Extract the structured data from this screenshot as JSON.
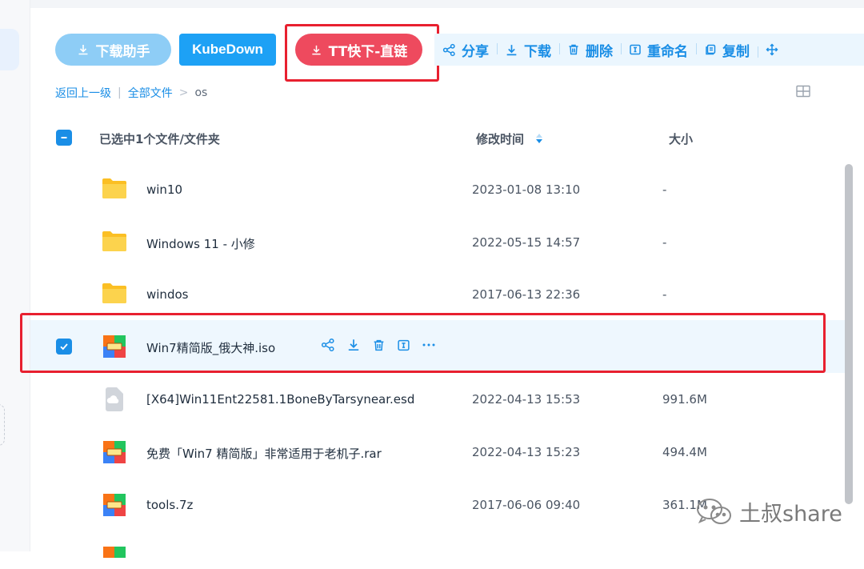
{
  "toolbar": {
    "helper_label": "下载助手",
    "kube_label": "KubeDown",
    "tt_label": "TT快下-直链",
    "actions": [
      {
        "label": "分享",
        "icon": "share-icon"
      },
      {
        "label": "下载",
        "icon": "download-icon"
      },
      {
        "label": "删除",
        "icon": "trash-icon"
      },
      {
        "label": "重命名",
        "icon": "rename-icon"
      },
      {
        "label": "复制",
        "icon": "copy-icon"
      }
    ]
  },
  "breadcrumb": {
    "back": "返回上一级",
    "sep1": "|",
    "all": "全部文件",
    "sep2": ">",
    "current": "os"
  },
  "list_header": {
    "selected_text": "已选中1个文件/文件夹",
    "mtime": "修改时间",
    "size": "大小"
  },
  "files": [
    {
      "name": "win10",
      "mtime": "2023-01-08 13:10",
      "size": "-",
      "type": "folder"
    },
    {
      "name": "Windows 11 - 小修",
      "mtime": "2022-05-15 14:57",
      "size": "-",
      "type": "folder"
    },
    {
      "name": "windos",
      "mtime": "2017-06-13 22:36",
      "size": "-",
      "type": "folder"
    },
    {
      "name": "Win7精简版_俄大神.iso",
      "mtime": "",
      "size": "",
      "type": "archive",
      "selected": true
    },
    {
      "name": "[X64]Win11Ent22581.1BoneByTarsynear.esd",
      "mtime": "2022-04-13 15:53",
      "size": "991.6M",
      "type": "cloud-file"
    },
    {
      "name": "免费「Win7 精简版」非常适用于老机子.rar",
      "mtime": "2022-04-13 15:23",
      "size": "494.4M",
      "type": "archive"
    },
    {
      "name": "tools.7z",
      "mtime": "2017-06-06 09:40",
      "size": "361.1M",
      "type": "archive"
    }
  ],
  "watermark": "土叔share",
  "colors": {
    "accent": "#1a8ee6",
    "tt": "#ee4a5e",
    "highlight_box": "#e8202f"
  }
}
